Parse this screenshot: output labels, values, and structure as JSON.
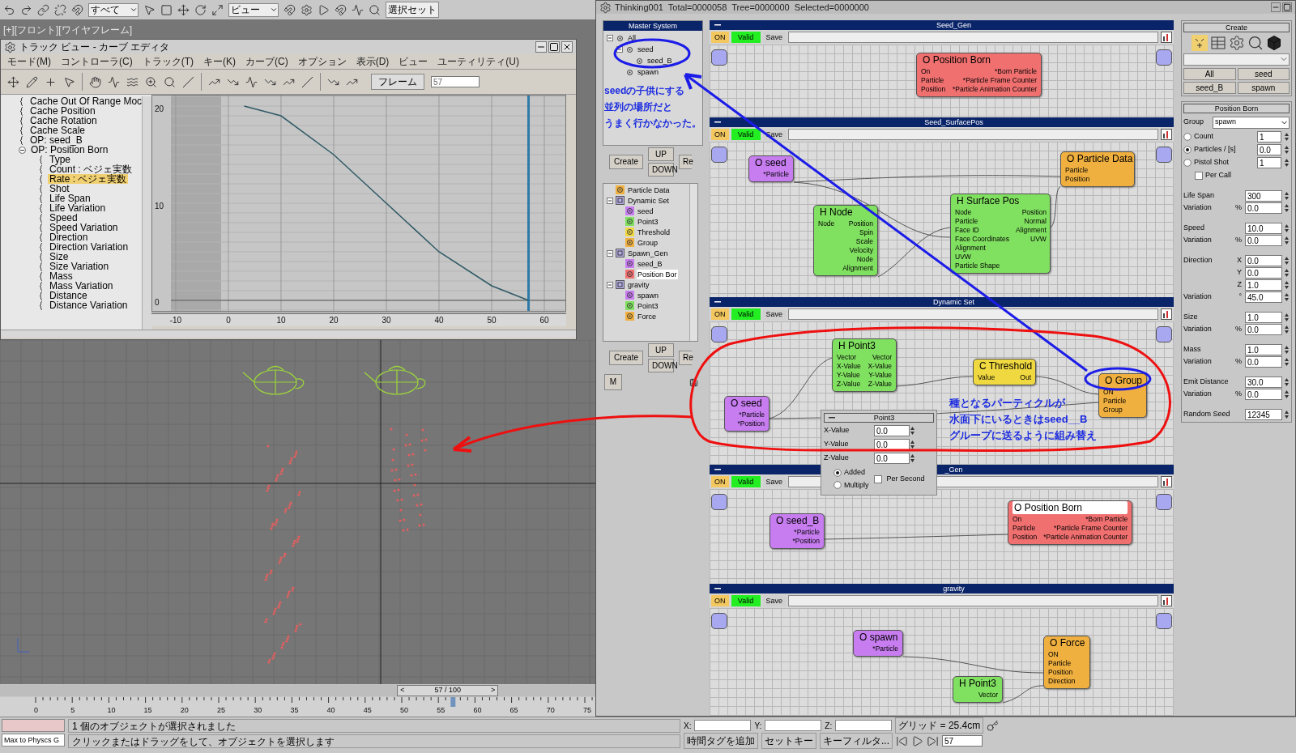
{
  "toolbar": {
    "selection_filter": "すべて",
    "reference_coord": "ビュー",
    "selection_set": "選択セット"
  },
  "viewport_label": "[+][フロント][ワイヤフレーム]",
  "curve_editor": {
    "title": "トラック ビュー - カーブ エディタ",
    "menu": [
      "モード(M)",
      "コントローラ(C)",
      "トラック(T)",
      "キー(K)",
      "カーブ(C)",
      "オプション",
      "表示(D)",
      "ビュー",
      "ユーティリティ(U)"
    ],
    "frame_label": "フレーム",
    "frame_value": "57",
    "tree": [
      {
        "label": "Cache Out Of Range Moc",
        "selected": false
      },
      {
        "label": "Cache Position",
        "selected": false
      },
      {
        "label": "Cache Rotation",
        "selected": false
      },
      {
        "label": "Cache Scale",
        "selected": false
      },
      {
        "label": "OP: seed_B",
        "selected": false
      },
      {
        "label": "OP: Position Born",
        "selected": false,
        "expanded": true,
        "children": [
          {
            "label": "Type",
            "selected": false
          },
          {
            "label": "Count : ベジェ実数",
            "selected": false
          },
          {
            "label": "Rate : ベジェ実数",
            "selected": true
          },
          {
            "label": "Shot",
            "selected": false
          },
          {
            "label": "Life Span",
            "selected": false
          },
          {
            "label": "Life Variation",
            "selected": false
          },
          {
            "label": "Speed",
            "selected": false
          },
          {
            "label": "Speed Variation",
            "selected": false
          },
          {
            "label": "Direction",
            "selected": false
          },
          {
            "label": "Direction Variation",
            "selected": false
          },
          {
            "label": "Size",
            "selected": false
          },
          {
            "label": "Size Variation",
            "selected": false
          },
          {
            "label": "Mass",
            "selected": false
          },
          {
            "label": "Mass Variation",
            "selected": false
          },
          {
            "label": "Distance",
            "selected": false
          },
          {
            "label": "Distance Variation",
            "selected": false
          }
        ]
      }
    ],
    "chart_data": {
      "type": "line",
      "x": [
        3,
        10,
        20,
        30,
        40,
        50,
        57
      ],
      "series": [
        {
          "color": "#2f5a66",
          "values": [
            20,
            19,
            15,
            10,
            5,
            1.5,
            0
          ]
        }
      ],
      "xlim": [
        -14.6,
        64.15
      ],
      "ylim": [
        -1.17,
        21.17
      ],
      "grid": true,
      "ref_lines": [
        {
          "axis": "y",
          "value": 0
        },
        {
          "axis": "x",
          "value": 57
        }
      ],
      "xticks": [
        -10,
        0,
        10,
        20,
        30,
        40,
        50,
        60
      ],
      "yticks": [
        0,
        10,
        20
      ]
    }
  },
  "timeline": {
    "prev": "<",
    "label": "57 / 100",
    "next": ">",
    "level": 0.57,
    "ticks": [
      "0",
      "5",
      "10",
      "15",
      "20",
      "25",
      "30",
      "35",
      "40",
      "45",
      "50",
      "55",
      "60",
      "65",
      "70",
      "75"
    ]
  },
  "thinking": {
    "title": "Thinking001  Total=0000058  Tree=0000000  Selected=0000000",
    "master_system": {
      "title": "Master System",
      "tree": [
        {
          "label": "All",
          "selected": false,
          "expanded": true,
          "children": [
            {
              "label": "seed",
              "selected": false,
              "expanded": true,
              "children": [
                {
                  "label": "seed_B",
                  "selected": false
                }
              ]
            },
            {
              "label": "spawn",
              "selected": false
            }
          ]
        }
      ],
      "note": [
        "seedの子供にする",
        "並列の場所だと",
        "うまく行かなかった。"
      ],
      "create": "Create",
      "up": "UP",
      "down": "DOWN",
      "remove": "Re"
    },
    "operator_tree": {
      "items": [
        {
          "label": "Particle Data",
          "selected": false,
          "color": "#f0b040"
        },
        {
          "label": "Dynamic Set",
          "selected": false,
          "expanded": true,
          "children": [
            {
              "label": "seed",
              "selected": false,
              "color": "#c77df0"
            },
            {
              "label": "Point3",
              "selected": false,
              "color": "#80e060"
            },
            {
              "label": "Threshold",
              "selected": false,
              "color": "#f0d840"
            },
            {
              "label": "Group",
              "selected": false,
              "color": "#f0b040"
            }
          ]
        },
        {
          "label": "Spawn_Gen",
          "selected": false,
          "expanded": true,
          "children": [
            {
              "label": "seed_B",
              "selected": false,
              "color": "#c77df0"
            },
            {
              "label": "Position Bor",
              "selected": true,
              "color": "#f07070"
            }
          ]
        },
        {
          "label": "gravity",
          "selected": false,
          "expanded": true,
          "children": [
            {
              "label": "spawn",
              "selected": false,
              "color": "#c77df0"
            },
            {
              "label": "Point3",
              "selected": false,
              "color": "#80e060"
            },
            {
              "label": "Force",
              "selected": false,
              "color": "#f0b040"
            }
          ]
        }
      ],
      "create": "Create",
      "up": "UP",
      "down": "DOWN",
      "remove": "Re",
      "macro": "M"
    },
    "sections": [
      {
        "title": "Seed_Gen",
        "on": "ON",
        "valid": "Valid",
        "save": "Save",
        "nodes": [
          {
            "title": "O Position Born",
            "color": "#f07070",
            "selected": false,
            "in": [
              "On",
              "Particle",
              "Position"
            ],
            "out": [
              "*Born Particle",
              "*Particle Frame Counter",
              "*Particle Animation Counter"
            ]
          }
        ]
      },
      {
        "title": "Seed_SurfacePos",
        "on": "ON",
        "valid": "Valid",
        "save": "Save",
        "nodes": [
          {
            "title": "O seed",
            "color": "#c77df0",
            "selected": false,
            "out": [
              "*Particle"
            ]
          },
          {
            "title": "O Particle Data",
            "color": "#f0b040",
            "selected": false,
            "in": [
              "Particle",
              "Position"
            ]
          },
          {
            "title": "H Node",
            "color": "#80e060",
            "selected": false,
            "in": [
              "Node"
            ],
            "out": [
              "Position",
              "Spin",
              "Scale",
              "Velocity",
              "Node",
              "Alignment"
            ]
          },
          {
            "title": "H Surface Pos",
            "color": "#80e060",
            "selected": false,
            "in": [
              "Node",
              "Particle",
              "Face ID",
              "Face Coordinates",
              "Alignment",
              "UVW",
              "Particle Shape"
            ],
            "out": [
              "Position",
              "Normal",
              "Alignment",
              "UVW"
            ]
          }
        ]
      },
      {
        "title": "Dynamic Set",
        "on": "ON",
        "valid": "Valid",
        "save": "Save",
        "nodes": [
          {
            "title": "H Point3",
            "color": "#80e060",
            "selected": false,
            "in": [
              "Vector",
              "X-Value",
              "Y-Value",
              "Z-Value"
            ],
            "out": [
              "Vector",
              "X-Value",
              "Y-Value",
              "Z-Value"
            ]
          },
          {
            "title": "C Threshold",
            "color": "#f0d840",
            "selected": false,
            "in": [
              "Value"
            ],
            "out": [
              "Out"
            ]
          },
          {
            "title": "O Group",
            "color": "#f0b040",
            "selected": false,
            "in": [
              "ON",
              "Particle",
              "Group"
            ]
          },
          {
            "title": "O seed",
            "color": "#c77df0",
            "selected": false,
            "out": [
              "*Particle",
              "*Position"
            ]
          }
        ]
      },
      {
        "title": "_Gen",
        "on": "ON",
        "valid": "Valid",
        "save": "Save",
        "nodes": [
          {
            "title": "O seed_B",
            "color": "#c77df0",
            "selected": false,
            "out": [
              "*Particle",
              "*Position"
            ]
          },
          {
            "title": "O Position Born",
            "color": "#f07070",
            "selected": true,
            "in": [
              "On",
              "Particle",
              "Position"
            ],
            "out": [
              "*Born Particle",
              "*Particle Frame Counter",
              "*Particle Animation Counter"
            ]
          }
        ]
      },
      {
        "title": "gravity",
        "on": "ON",
        "valid": "Valid",
        "save": "Save",
        "nodes": [
          {
            "title": "O spawn",
            "color": "#c77df0",
            "selected": false,
            "out": [
              "*Particle"
            ]
          },
          {
            "title": "O Force",
            "color": "#f0b040",
            "selected": false,
            "in": [
              "ON",
              "Particle",
              "Position",
              "Direction"
            ]
          },
          {
            "title": "H Point3",
            "color": "#80e060",
            "selected": false,
            "out": [
              "Vector"
            ]
          }
        ]
      }
    ],
    "dynamic_note": [
      "種となるパーティクルが",
      "水面下にいるときはseed__B",
      "グループに送るように組み替え"
    ],
    "point3_popup": {
      "title": "Point3",
      "fields": [
        {
          "label": "X-Value",
          "value": "0.0"
        },
        {
          "label": "Y-Value",
          "value": "0.0"
        },
        {
          "label": "Z-Value",
          "value": "0.0"
        }
      ],
      "modes": [
        {
          "label": "Added",
          "selected": true
        },
        {
          "label": "Multiply",
          "selected": false
        }
      ],
      "per_second": {
        "label": "Per Second",
        "checked": false
      }
    },
    "create_panel": {
      "title": "Create",
      "buttons": [
        "All",
        "seed",
        "seed_B",
        "spawn"
      ]
    },
    "position_born_panel": {
      "title": "Position Born",
      "group_label": "Group",
      "group_value": "spawn",
      "emit_modes": [
        {
          "label": "Count",
          "value": "1",
          "selected": false
        },
        {
          "label": "Particles / [s]",
          "value": "0.0",
          "selected": true
        },
        {
          "label": "Pistol Shot",
          "value": "1",
          "selected": false
        }
      ],
      "per_call": {
        "label": "Per Call",
        "checked": false
      },
      "field_groups": [
        [
          {
            "label": "Life Span",
            "value": "300"
          },
          {
            "label": "Variation",
            "unit": "%",
            "value": "0.0"
          }
        ],
        [
          {
            "label": "Speed",
            "value": "10.0"
          },
          {
            "label": "Variation",
            "unit": "%",
            "value": "0.0"
          }
        ],
        [
          {
            "label": "Direction",
            "unit": "X",
            "value": "0.0"
          },
          {
            "unit": "Y",
            "value": "0.0"
          },
          {
            "unit": "Z",
            "value": "1.0"
          },
          {
            "label": "Variation",
            "unit": "°",
            "value": "45.0"
          }
        ],
        [
          {
            "label": "Size",
            "value": "1.0"
          },
          {
            "label": "Variation",
            "unit": "%",
            "value": "0.0"
          }
        ],
        [
          {
            "label": "Mass",
            "value": "1.0"
          },
          {
            "label": "Variation",
            "unit": "%",
            "value": "0.0"
          }
        ],
        [
          {
            "label": "Emit Distance",
            "value": "30.0"
          },
          {
            "label": "Variation",
            "unit": "%",
            "value": "0.0"
          }
        ],
        [
          {
            "label": "Random Seed",
            "value": "12345"
          }
        ]
      ]
    }
  },
  "status_bar": {
    "script_field": "Max to Physcs G",
    "message": "1 個のオブジェクトが選択されました",
    "prompt": "クリックまたはドラッグをして、オブジェクトを選択します",
    "x_label": "X:",
    "y_label": "Y:",
    "z_label": "Z:",
    "grid": "グリッド = 25.4cm",
    "add_time_tag": "時間タグを追加",
    "set_key": "セットキー",
    "key_filters": "キーフィルタ...",
    "frame": "57"
  }
}
